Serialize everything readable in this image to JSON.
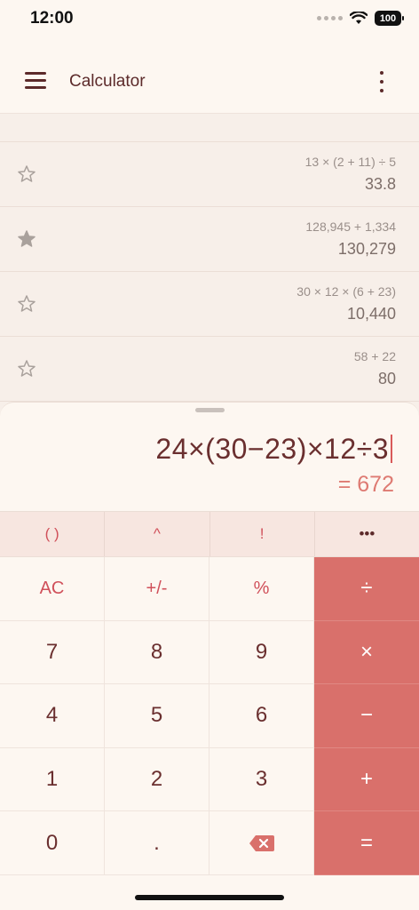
{
  "status": {
    "time": "12:00",
    "battery": "100"
  },
  "app": {
    "title": "Calculator"
  },
  "history": [
    {
      "expression": "13 × (2 + 11) ÷ 5",
      "result": "33.8",
      "starred": false
    },
    {
      "expression": "128,945 + 1,334",
      "result": "130,279",
      "starred": true
    },
    {
      "expression": "30 × 12 × (6 + 23)",
      "result": "10,440",
      "starred": false
    },
    {
      "expression": "58 + 22",
      "result": "80",
      "starred": false
    }
  ],
  "display": {
    "input": "24×(30−23)×12÷3",
    "preview": "= 672"
  },
  "scientific_keys": [
    "( )",
    "^",
    "!",
    "•••"
  ],
  "keys": [
    {
      "label": "AC",
      "kind": "func"
    },
    {
      "label": "+/-",
      "kind": "func"
    },
    {
      "label": "%",
      "kind": "func"
    },
    {
      "label": "÷",
      "kind": "op"
    },
    {
      "label": "7",
      "kind": "num"
    },
    {
      "label": "8",
      "kind": "num"
    },
    {
      "label": "9",
      "kind": "num"
    },
    {
      "label": "×",
      "kind": "op"
    },
    {
      "label": "4",
      "kind": "num"
    },
    {
      "label": "5",
      "kind": "num"
    },
    {
      "label": "6",
      "kind": "num"
    },
    {
      "label": "−",
      "kind": "op"
    },
    {
      "label": "1",
      "kind": "num"
    },
    {
      "label": "2",
      "kind": "num"
    },
    {
      "label": "3",
      "kind": "num"
    },
    {
      "label": "+",
      "kind": "op"
    },
    {
      "label": "0",
      "kind": "num"
    },
    {
      "label": ".",
      "kind": "num"
    },
    {
      "label": "",
      "kind": "backspace"
    },
    {
      "label": "=",
      "kind": "op"
    }
  ],
  "colors": {
    "accent": "#d9706b",
    "text": "#6a2f2f",
    "sheet": "#fdf7f1"
  }
}
